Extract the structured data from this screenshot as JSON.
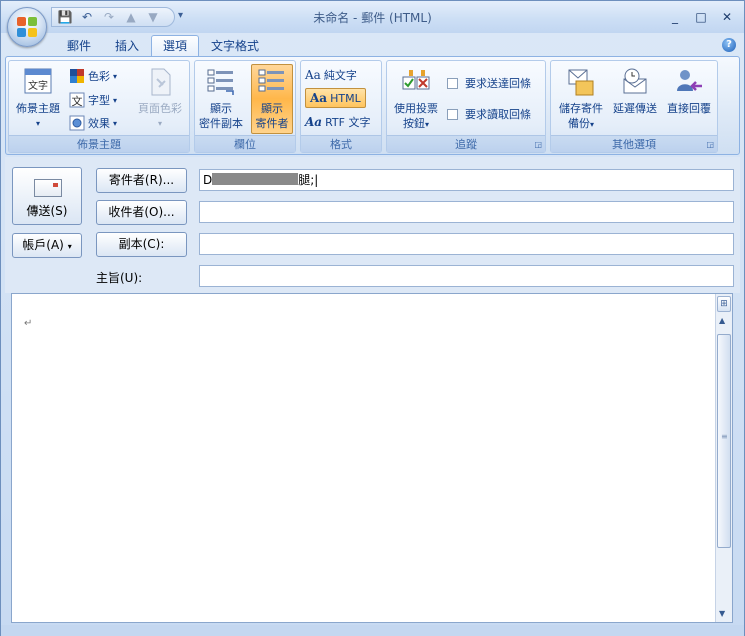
{
  "window": {
    "title": "未命名 - 郵件 (HTML)",
    "controls": {
      "minimize": "_",
      "maximize": "□",
      "close": "✕"
    }
  },
  "qat": {
    "save": "💾",
    "undo": "↶",
    "redo": "↷",
    "up": "▲",
    "down": "▼",
    "more": "▾"
  },
  "tabs": [
    {
      "label": "郵件",
      "active": false
    },
    {
      "label": "插入",
      "active": false
    },
    {
      "label": "選項",
      "active": true
    },
    {
      "label": "文字格式",
      "active": false
    }
  ],
  "help": "?",
  "ribbon": {
    "themes": {
      "group_label": "佈景主題",
      "theme_label": "佈景主題",
      "colors_label": "色彩",
      "fonts_label": "字型",
      "effects_label": "效果",
      "page_color_label": "頁面色彩"
    },
    "fields": {
      "group_label": "欄位",
      "show_bcc_label_1": "顯示",
      "show_bcc_label_2": "密件副本",
      "show_from_label_1": "顯示",
      "show_from_label_2": "寄件者"
    },
    "format": {
      "group_label": "格式",
      "plain_label": "純文字",
      "html_label": "HTML",
      "rtf_label": "RTF 文字",
      "aa": "Aa"
    },
    "tracking": {
      "group_label": "追蹤",
      "voting_label_1": "使用投票",
      "voting_label_2": "按鈕",
      "delivery_receipt_label": "要求送達回條",
      "read_receipt_label": "要求讀取回條"
    },
    "more": {
      "group_label": "其他選項",
      "save_sent_label_1": "儲存寄件",
      "save_sent_label_2": "備份",
      "delay_label": "延遲傳送",
      "direct_label": "直接回覆"
    }
  },
  "compose": {
    "send_label": "傳送(S)",
    "account_label": "帳戶(A)",
    "from_label": "寄件者(R)...",
    "to_label": "收件者(O)...",
    "cc_label": "副本(C):",
    "subject_label": "主旨(U):",
    "from_value_prefix": "D",
    "from_value_suffix": "腿;",
    "to_value": "",
    "cc_value": "",
    "subject_value": ""
  },
  "editor": {
    "paragraph_mark": "↵"
  },
  "colors": {
    "accent": "#15428b",
    "pressed": "#ffc45e",
    "ribbon_border": "#8db2e3"
  }
}
